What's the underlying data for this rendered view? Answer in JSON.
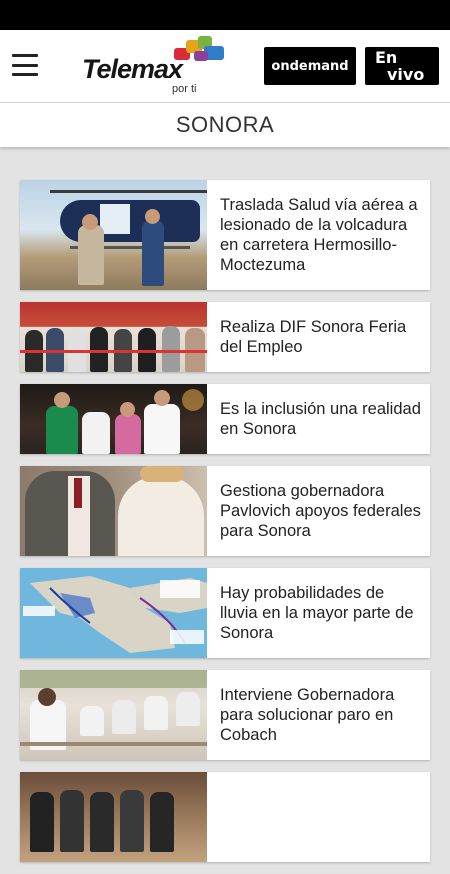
{
  "header": {
    "menu_icon": "hamburger-menu-icon",
    "logo": {
      "wordmark": "Telemax",
      "tagline": "por ti",
      "block_colors": [
        "#d82b3b",
        "#e8a31e",
        "#7ab241",
        "#2f7dc4",
        "#8d3f9c"
      ]
    },
    "ondemand_label": "ondemand",
    "envivo_line1": "En",
    "envivo_line2": "vivo"
  },
  "section": {
    "title": "SONORA"
  },
  "articles": [
    {
      "title": "Traslada Salud vía aérea a lesionado de la volcadura en carretera Hermosillo-Moctezuma",
      "thumb": "helicopter-photo"
    },
    {
      "title": "Realiza DIF Sonora Feria del Empleo",
      "thumb": "ribbon-cutting-photo"
    },
    {
      "title": "Es la inclusión una realidad en Sonora",
      "thumb": "event-photo"
    },
    {
      "title": "Gestiona gobernadora Pavlovich apoyos federales para Sonora",
      "thumb": "officials-photo"
    },
    {
      "title": "Hay probabilidades de lluvia en la mayor parte de Sonora",
      "thumb": "weather-map"
    },
    {
      "title": "Interviene Gobernadora para solucionar paro en Cobach",
      "thumb": "classroom-photo"
    },
    {
      "title": "",
      "thumb": "group-photo"
    }
  ]
}
